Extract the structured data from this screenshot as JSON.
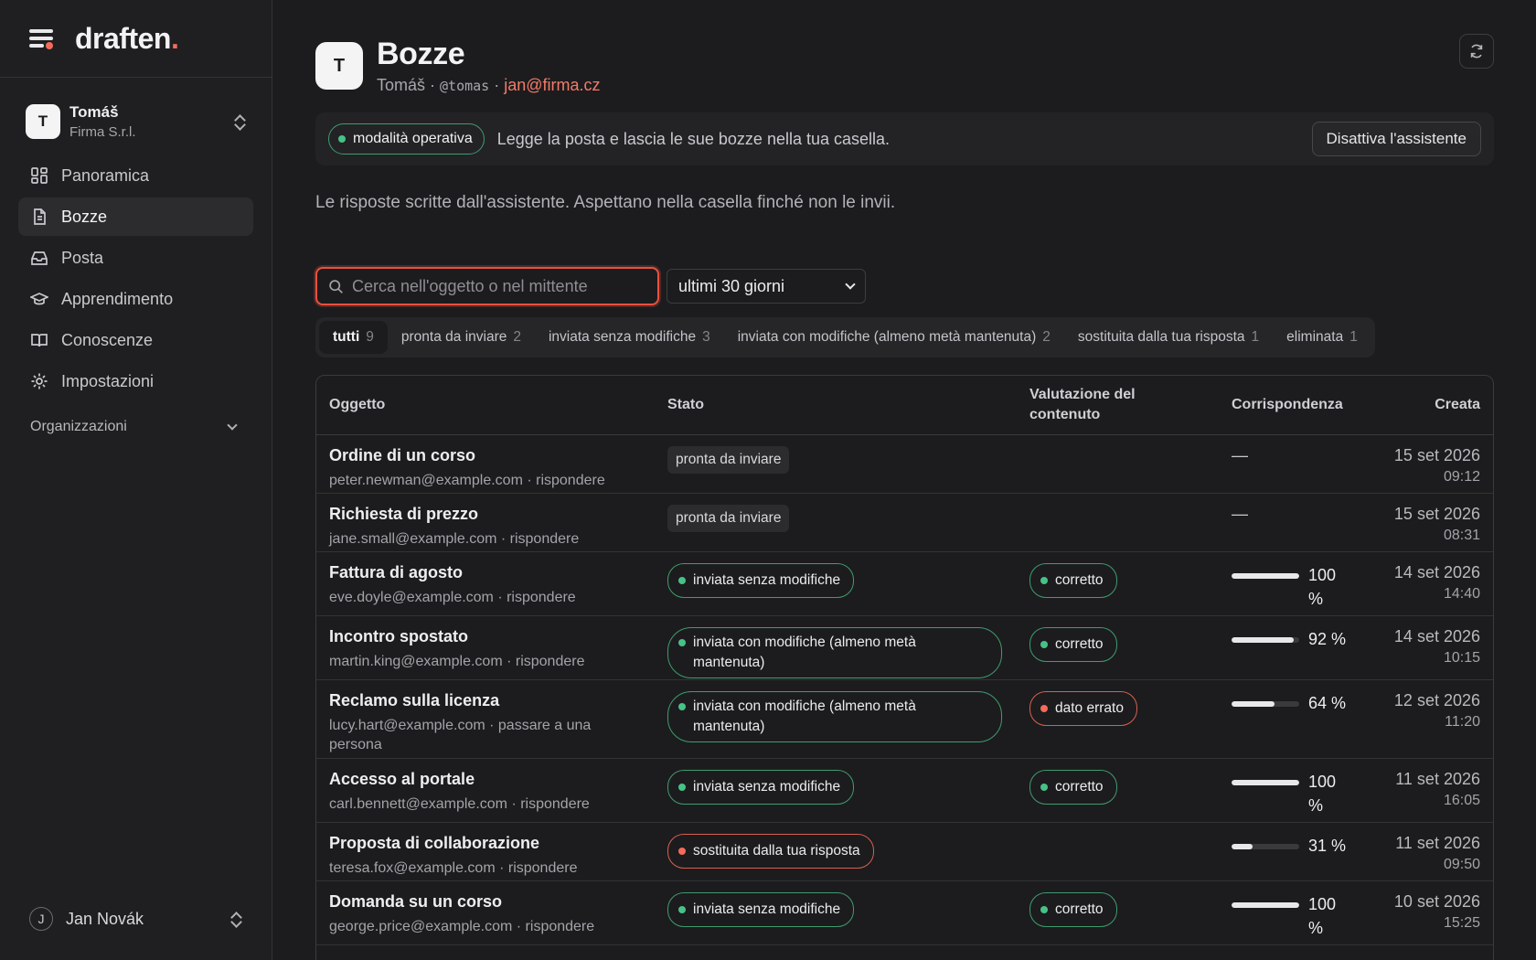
{
  "brand": {
    "name": "draften",
    "dot": "."
  },
  "account": {
    "initial": "T",
    "name": "Tomáš",
    "org": "Firma S.r.l."
  },
  "nav": [
    {
      "label": "Panoramica",
      "icon": "dashboard-icon"
    },
    {
      "label": "Bozze",
      "icon": "document-icon"
    },
    {
      "label": "Posta",
      "icon": "inbox-icon"
    },
    {
      "label": "Apprendimento",
      "icon": "graduation-cap-icon"
    },
    {
      "label": "Conoscenze",
      "icon": "book-icon"
    },
    {
      "label": "Impostazioni",
      "icon": "gear-icon"
    }
  ],
  "org_section": "Organizzazioni",
  "user": {
    "initial": "J",
    "name": "Jan Novák"
  },
  "header": {
    "initial": "T",
    "title": "Bozze",
    "owner": "Tomáš · ",
    "handle": "@tomas",
    "sep": " · ",
    "email": "jan@firma.cz"
  },
  "mode": {
    "badge": "modalità operativa",
    "text": "Legge la posta e lascia le sue bozze nella tua casella.",
    "button": "Disattiva l'assistente"
  },
  "description": "Le risposte scritte dall'assistente. Aspettano nella casella finché non le invii.",
  "search": {
    "placeholder": "Cerca nell'oggetto o nel mittente",
    "value": ""
  },
  "period": {
    "selected": "ultimi 30 giorni"
  },
  "filters": [
    {
      "label": "tutti",
      "count": "9"
    },
    {
      "label": "pronta da inviare",
      "count": "2"
    },
    {
      "label": "inviata senza modifiche",
      "count": "3"
    },
    {
      "label": "inviata con modifiche (almeno metà mantenuta)",
      "count": "2"
    },
    {
      "label": "sostituita dalla tua risposta",
      "count": "1"
    },
    {
      "label": "eliminata",
      "count": "1"
    }
  ],
  "table": {
    "headers": {
      "subject": "Oggetto",
      "status": "Stato",
      "rating": "Valutazione del contenuto",
      "match": "Corrispondenza",
      "created": "Creata"
    },
    "rows": [
      {
        "subject": "Ordine di un corso",
        "meta": "peter.newman@example.com · rispondere",
        "status": "pronta da inviare",
        "status_style": "plain",
        "rating": "",
        "rating_style": "",
        "match": null,
        "match_text": "—",
        "date": "15 set 2026",
        "time": "09:12"
      },
      {
        "subject": "Richiesta di prezzo",
        "meta": "jane.small@example.com · rispondere",
        "status": "pronta da inviare",
        "status_style": "plain",
        "rating": "",
        "rating_style": "",
        "match": null,
        "match_text": "—",
        "date": "15 set 2026",
        "time": "08:31"
      },
      {
        "subject": "Fattura di agosto",
        "meta": "eve.doyle@example.com · rispondere",
        "status": "inviata senza modifiche",
        "status_style": "green",
        "rating": "corretto",
        "rating_style": "green",
        "match": 100,
        "match_text": "100 %",
        "date": "14 set 2026",
        "time": "14:40"
      },
      {
        "subject": "Incontro spostato",
        "meta": "martin.king@example.com · rispondere",
        "status": "inviata con modifiche (almeno metà mantenuta)",
        "status_style": "green-wide",
        "rating": "corretto",
        "rating_style": "green",
        "match": 92,
        "match_text": "92 %",
        "date": "14 set 2026",
        "time": "10:15"
      },
      {
        "subject": "Reclamo sulla licenza",
        "meta": "lucy.hart@example.com · passare a una persona",
        "status": "inviata con modifiche (almeno metà mantenuta)",
        "status_style": "green-wide",
        "rating": "dato errato",
        "rating_style": "red",
        "match": 64,
        "match_text": "64 %",
        "date": "12 set 2026",
        "time": "11:20"
      },
      {
        "subject": "Accesso al portale",
        "meta": "carl.bennett@example.com · rispondere",
        "status": "inviata senza modifiche",
        "status_style": "green",
        "rating": "corretto",
        "rating_style": "green",
        "match": 100,
        "match_text": "100 %",
        "date": "11 set 2026",
        "time": "16:05"
      },
      {
        "subject": "Proposta di collaborazione",
        "meta": "teresa.fox@example.com · rispondere",
        "status": "sostituita dalla tua risposta",
        "status_style": "red",
        "rating": "",
        "rating_style": "",
        "match": 31,
        "match_text": "31 %",
        "date": "11 set 2026",
        "time": "09:50"
      },
      {
        "subject": "Domanda su un corso",
        "meta": "george.price@example.com · rispondere",
        "status": "inviata senza modifiche",
        "status_style": "green",
        "rating": "corretto",
        "rating_style": "green",
        "match": 100,
        "match_text": "100 %",
        "date": "10 set 2026",
        "time": "15:25"
      }
    ]
  },
  "colors": {
    "accent": "#f26b5b",
    "green": "#47c287",
    "red": "#f26b5b",
    "background": "#1c1c1e"
  }
}
